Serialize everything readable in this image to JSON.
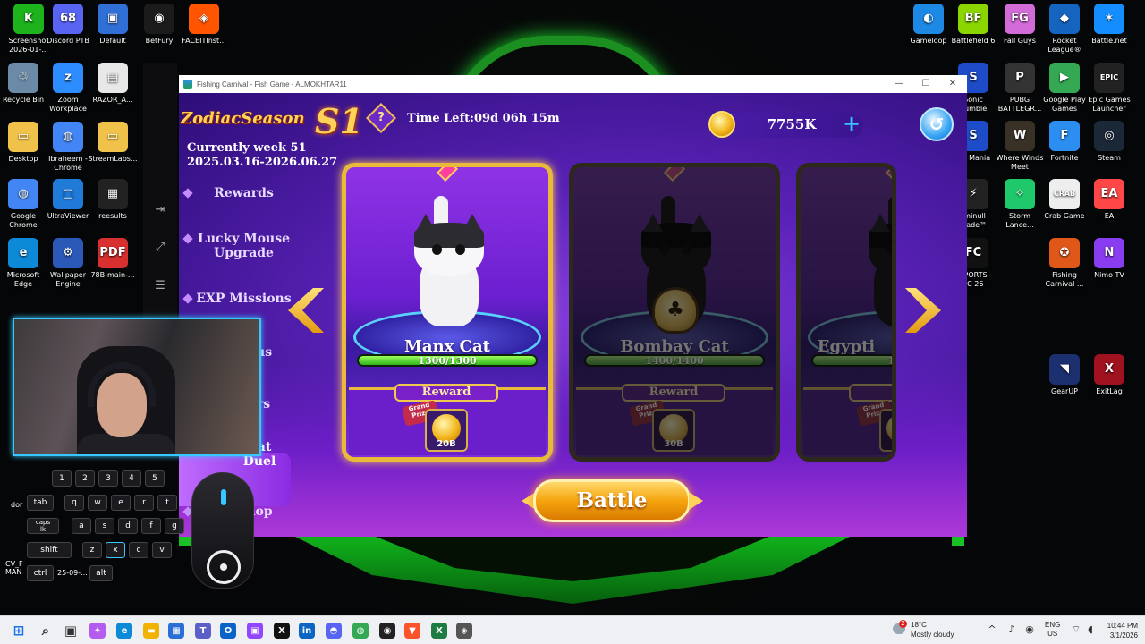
{
  "desktop_left": [
    {
      "label": "Screenshot\n2026-01-...",
      "color": "#1db31d",
      "glyph": "K"
    },
    {
      "label": "Discord PTB",
      "color": "#5865f2",
      "glyph": "68"
    },
    {
      "label": "Default",
      "color": "#2f6fd6",
      "glyph": "▣"
    },
    {
      "label": "BetFury",
      "color": "#1b1b1b",
      "glyph": "◉"
    },
    {
      "label": "FACEITInst...",
      "color": "#ff5500",
      "glyph": "◈"
    },
    {
      "label": "Recycle Bin",
      "color": "#6a8aa8",
      "glyph": "♲"
    },
    {
      "label": "Zoom\nWorkplace",
      "color": "#2d8cff",
      "glyph": "z"
    },
    {
      "label": "RAZOR_A...",
      "color": "#e8e8e8",
      "glyph": "▤"
    },
    {
      "label": "Desktop",
      "color": "#f0c24a",
      "glyph": "▭"
    },
    {
      "label": "Ibraheem -\nChrome",
      "color": "#4285f4",
      "glyph": "◍"
    },
    {
      "label": "StreamLabs...",
      "color": "#f0c24a",
      "glyph": "▭"
    },
    {
      "label": "Google\nChrome",
      "color": "#4285f4",
      "glyph": "◍"
    },
    {
      "label": "UltraViewer",
      "color": "#1f7ad8",
      "glyph": "▢"
    },
    {
      "label": "reesults",
      "color": "#222",
      "glyph": "▦"
    },
    {
      "label": "Microsoft\nEdge",
      "color": "#0c8ad8",
      "glyph": "e"
    },
    {
      "label": "Wallpaper\nEngine",
      "color": "#2a59b8",
      "glyph": "⚙"
    },
    {
      "label": "78B-main-...",
      "color": "#d83030",
      "glyph": "PDF"
    }
  ],
  "desktop_right": [
    {
      "label": "Gameloop",
      "color": "#1e88e5",
      "glyph": "◐"
    },
    {
      "label": "Battlefield 6",
      "color": "#8bd600",
      "glyph": "BF"
    },
    {
      "label": "Fall Guys",
      "color": "#d26ad8",
      "glyph": "FG"
    },
    {
      "label": "Rocket\nLeague®",
      "color": "#1565c0",
      "glyph": "◆"
    },
    {
      "label": "Battle.net",
      "color": "#148eff",
      "glyph": "✶"
    },
    {
      "label": "Sonic\nRumble",
      "color": "#1e4cc8",
      "glyph": "S"
    },
    {
      "label": "PUBG\nBATTLEGR...",
      "color": "#333",
      "glyph": "P"
    },
    {
      "label": "Google Play\nGames",
      "color": "#34a853",
      "glyph": "▶"
    },
    {
      "label": "Epic Games\nLauncher",
      "color": "#222",
      "glyph": "EPIC"
    },
    {
      "label": "nic Mania",
      "color": "#1e4cc8",
      "glyph": "S"
    },
    {
      "label": "Where Winds\nMeet",
      "color": "#3a3126",
      "glyph": "W"
    },
    {
      "label": "Fortnite",
      "color": "#2b8ef0",
      "glyph": "F"
    },
    {
      "label": "Steam",
      "color": "#1b2838",
      "glyph": "◎"
    },
    {
      "label": "rminull\nigade™",
      "color": "#222",
      "glyph": "⚡"
    },
    {
      "label": "Storm\nLance...",
      "color": "#1fc86a",
      "glyph": "✧"
    },
    {
      "label": "Crab Game",
      "color": "#eee",
      "glyph": "CRAB"
    },
    {
      "label": "EA",
      "color": "#ff4747",
      "glyph": "EA"
    },
    {
      "label": "SPORTS\nFC 26",
      "color": "#111",
      "glyph": "FC"
    },
    {
      "label": "Fishing\nCarnival ...",
      "color": "#e0571a",
      "glyph": "✪"
    },
    {
      "label": "Nimo TV",
      "color": "#8a3cf0",
      "glyph": "N"
    },
    {
      "label": "GearUP",
      "color": "#1c2f6e",
      "glyph": "◥"
    },
    {
      "label": "ExitLag",
      "color": "#a0121f",
      "glyph": "X"
    }
  ],
  "window": {
    "title": "Fishing Carnival - Fish Game - ALMOKHTAR11",
    "minimize": "—",
    "maximize": "☐",
    "close": "✕"
  },
  "game": {
    "logo_text": "ZodiacSeason",
    "season_badge": "S1",
    "help_label": "?",
    "time_left": "Time Left:09d 06h 15m",
    "coins": "7755K",
    "add_coins_label": "+",
    "back_label": "↺",
    "week_line1": "Currently week 51",
    "week_line2": "2025.03.16-2026.06.27",
    "menu": [
      {
        "label": "Rewards"
      },
      {
        "label": "Lucky Mouse\nUpgrade"
      },
      {
        "label": "EXP Missions"
      },
      {
        "label": "nus"
      },
      {
        "label": "ers"
      },
      {
        "label": "Cat\nDuel"
      },
      {
        "label": "hop"
      }
    ],
    "prev_label": "‹",
    "next_label": "›",
    "cards": [
      {
        "name": "Manx Cat",
        "hp": "1300/1300",
        "hp_fraction": 1.0,
        "reward_label": "Reward",
        "grand_prize": "Grand\nPrize",
        "prize_amount": "20B",
        "locked": false
      },
      {
        "name": "Bombay Cat",
        "hp": "1400/1400",
        "hp_fraction": 1.0,
        "reward_label": "Reward",
        "grand_prize": "Grand\nPrize",
        "prize_amount": "30B",
        "locked": true
      },
      {
        "name": "Egypti",
        "hp": "1600",
        "hp_fraction": 1.0,
        "reward_label": "Re",
        "grand_prize": "Grand\nPrize",
        "prize_amount": "",
        "locked": true
      }
    ],
    "battle_label": "Battle"
  },
  "overlay": {
    "keys": [
      {
        "label": "1"
      },
      {
        "label": "2"
      },
      {
        "label": "3"
      },
      {
        "label": "4"
      },
      {
        "label": "5"
      },
      {
        "label": "tab"
      },
      {
        "label": "q"
      },
      {
        "label": "w"
      },
      {
        "label": "e"
      },
      {
        "label": "r"
      },
      {
        "label": "t"
      },
      {
        "label": "caps\nlk"
      },
      {
        "label": "a"
      },
      {
        "label": "s"
      },
      {
        "label": "d"
      },
      {
        "label": "f"
      },
      {
        "label": "g"
      },
      {
        "label": "shift"
      },
      {
        "label": "z"
      },
      {
        "label": "x"
      },
      {
        "label": "c"
      },
      {
        "label": "v"
      },
      {
        "label": "ctrl"
      },
      {
        "label": "alt"
      }
    ],
    "peek_labels": [
      "dor",
      "CV_F\nMAN",
      "25-09-..."
    ]
  },
  "taskbar": {
    "weather_temp": "18°C",
    "weather_desc": "Mostly cloudy",
    "weather_badge": "2",
    "lang_top": "ENG",
    "lang_bottom": "US",
    "time": "10:44 PM",
    "date": "3/1/2026",
    "apps": [
      {
        "name": "start-icon",
        "color": "#1a73e8",
        "glyph": "⊞"
      },
      {
        "name": "search-icon",
        "color": "#333",
        "glyph": "⌕"
      },
      {
        "name": "task-view-icon",
        "color": "#333",
        "glyph": "▣"
      },
      {
        "name": "copilot-icon",
        "color": "#b45cf0",
        "glyph": "✦"
      },
      {
        "name": "edge-icon",
        "color": "#0c8ad8",
        "glyph": "e"
      },
      {
        "name": "file-explorer-icon",
        "color": "#f0b400",
        "glyph": "▬"
      },
      {
        "name": "store-icon",
        "color": "#2b6fd6",
        "glyph": "▦"
      },
      {
        "name": "teams-icon",
        "color": "#5b5fc7",
        "glyph": "T"
      },
      {
        "name": "outlook-icon",
        "color": "#0a64c8",
        "glyph": "O"
      },
      {
        "name": "twitch-icon",
        "color": "#9146ff",
        "glyph": "▣"
      },
      {
        "name": "x-icon",
        "color": "#111",
        "glyph": "X"
      },
      {
        "name": "linkedin-icon",
        "color": "#0a66c2",
        "glyph": "in"
      },
      {
        "name": "discord-icon",
        "color": "#5865f2",
        "glyph": "◓"
      },
      {
        "name": "chrome-icon",
        "color": "#34a853",
        "glyph": "◍"
      },
      {
        "name": "obs-icon",
        "color": "#222",
        "glyph": "◉"
      },
      {
        "name": "brave-icon",
        "color": "#fb542b",
        "glyph": "▼"
      },
      {
        "name": "excel-icon",
        "color": "#1d7b44",
        "glyph": "X"
      },
      {
        "name": "game-icon",
        "color": "#555",
        "glyph": "◈"
      }
    ]
  }
}
